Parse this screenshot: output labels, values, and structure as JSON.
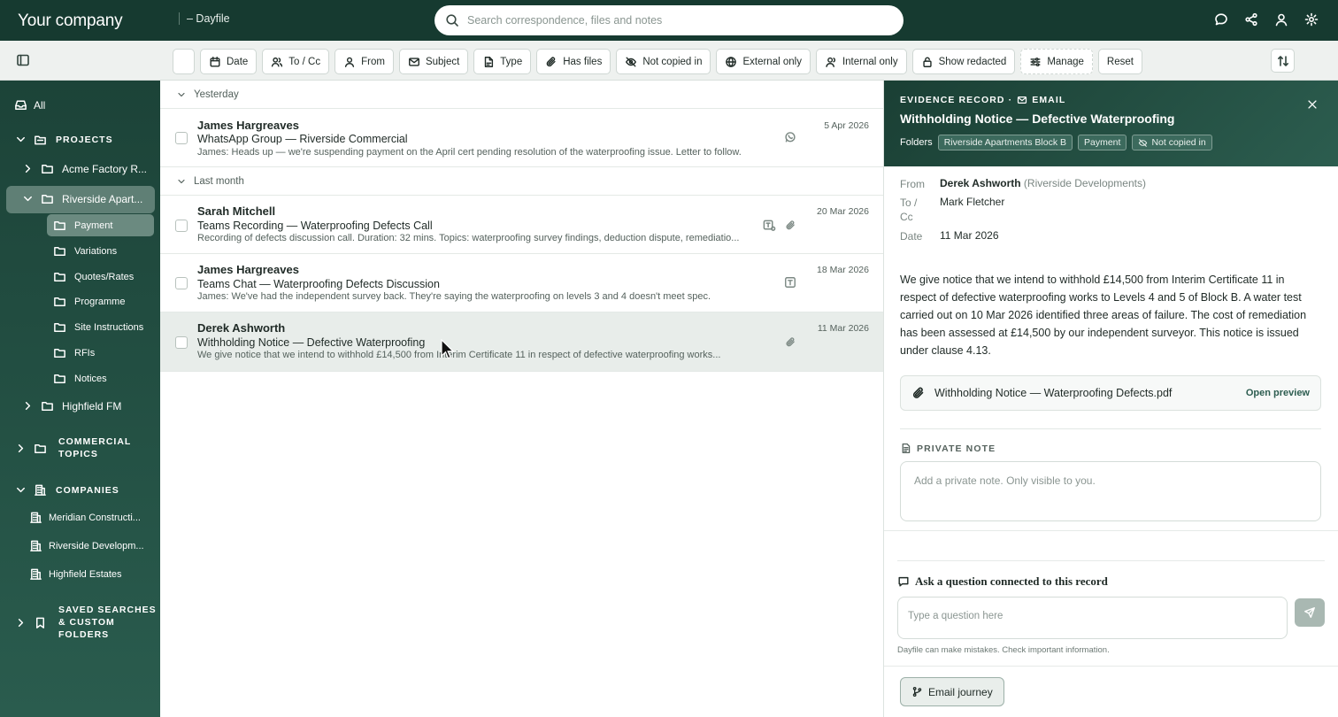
{
  "topbar": {
    "brand": "Your company",
    "product": "– Dayfile",
    "search_placeholder": "Search correspondence, files and notes",
    "icons": [
      "chat-icon",
      "share-icon",
      "user-icon",
      "gear-icon"
    ]
  },
  "filters": {
    "chips": [
      "Date",
      "To / Cc",
      "From",
      "Subject",
      "Type",
      "Has files",
      "Not copied in",
      "External only",
      "Internal only",
      "Show redacted",
      "Manage",
      "Reset"
    ]
  },
  "sidebar": {
    "all": "All",
    "projects_heading": "PROJECTS",
    "projects": [
      "Acme Factory R...",
      "Riverside Apart...",
      "Highfield FM"
    ],
    "subfolders": [
      "Payment",
      "Variations",
      "Quotes/Rates",
      "Programme",
      "Site Instructions",
      "RFIs",
      "Notices"
    ],
    "commercial_line1": "COMMERCIAL",
    "commercial_line2": "TOPICS",
    "companies_heading": "COMPANIES",
    "companies": [
      "Meridian Constructi...",
      "Riverside Developm...",
      "Highfield Estates"
    ],
    "saved_line1": "SAVED SEARCHES",
    "saved_line2": "& CUSTOM",
    "saved_line3": "FOLDERS"
  },
  "list": {
    "groups": [
      "Yesterday",
      "Last month"
    ],
    "items": [
      {
        "sender": "James Hargreaves",
        "subject": "WhatsApp Group — Riverside Commercial",
        "preview": "James: Heads up — we're suspending payment on the April cert pending resolution of the waterproofing issue. Letter to follow.",
        "date": "5 Apr 2026"
      },
      {
        "sender": "Sarah Mitchell",
        "subject": "Teams Recording — Waterproofing Defects Call",
        "preview": "Recording of defects discussion call. Duration: 32 mins. Topics: waterproofing survey findings, deduction dispute, remediatio...",
        "date": "20 Mar 2026"
      },
      {
        "sender": "James Hargreaves",
        "subject": "Teams Chat — Waterproofing Defects Discussion",
        "preview": "James: We've had the independent survey back. They're saying the waterproofing on levels 3 and 4 doesn't meet spec.",
        "date": "18 Mar 2026"
      },
      {
        "sender": "Derek Ashworth",
        "subject": "Withholding Notice — Defective Waterproofing",
        "preview": "We give notice that we intend to withhold £14,500 from Interim Certificate 11 in respect of defective waterproofing works...",
        "date": "11 Mar 2026"
      }
    ]
  },
  "detail": {
    "kind_prefix": "EVIDENCE RECORD ·",
    "kind": "EMAIL",
    "title": "Withholding Notice — Defective Waterproofing",
    "folders_label": "Folders",
    "tags": [
      "Riverside Apartments Block B",
      "Payment",
      "Not copied in"
    ],
    "from_label": "From",
    "from_name": "Derek Ashworth",
    "from_org": "(Riverside Developments)",
    "to_label": "To /",
    "cc_label": "Cc",
    "to_value": "Mark Fletcher",
    "date_label": "Date",
    "date_value": "11 Mar 2026",
    "body": "We give notice that we intend to withhold £14,500 from Interim Certificate 11 in respect of defective waterproofing works to Levels 4 and 5 of Block B. A water test carried out on 10 Mar 2026 identified three areas of failure. The cost of remediation has been assessed at £14,500 by our independent surveyor. This notice is issued under clause 4.13.",
    "attachment": "Withholding Notice — Waterproofing Defects.pdf",
    "open_preview": "Open preview",
    "private_note_label": "PRIVATE NOTE",
    "private_note_placeholder": "Add a private note. Only visible to you.",
    "ask_label": "Ask a question connected to this record",
    "ask_placeholder": "Type a question here",
    "disclaimer": "Dayfile can make mistakes. Check important information.",
    "journey_button": "Email journey"
  }
}
